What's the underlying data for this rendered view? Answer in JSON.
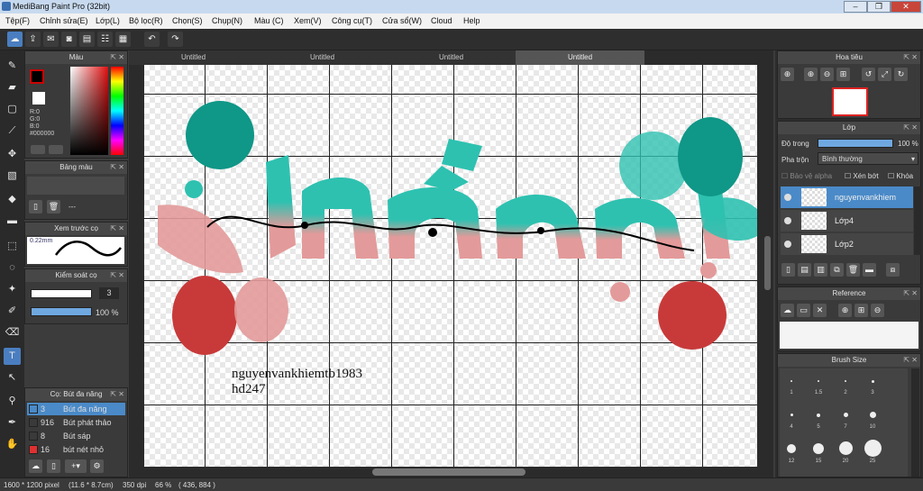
{
  "app": {
    "title": "MediBang Paint Pro (32bit)"
  },
  "menu": [
    "Tệp(F)",
    "Chỉnh sửa(E)",
    "Lớp(L)",
    "Bộ lọc(R)",
    "Chọn(S)",
    "Chụp(N)",
    "Màu (C)",
    "Xem(V)",
    "Công cụ(T)",
    "Cửa sổ(W)",
    "Cloud",
    "Help"
  ],
  "tabs": [
    "Untitled",
    "Untitled",
    "Untitled",
    "Untitled"
  ],
  "color_panel": {
    "title": "Màu",
    "r": "R:0",
    "g": "G:0",
    "b": "B:0",
    "hex": "#000000",
    "foreground": "#000000",
    "background": "#ffffff",
    "hue": "#ff0000"
  },
  "palette_panel": {
    "title": "Bảng màu",
    "dash": "---"
  },
  "brush_preview_panel": {
    "title": "Xem trước cọ",
    "size": "0.22mm"
  },
  "brush_control_panel": {
    "title": "Kiểm soát cọ",
    "size_value": "3",
    "opacity_value": "100 %"
  },
  "brush_list_panel": {
    "title": "Cọ: Bút đa năng",
    "items": [
      {
        "num": "3",
        "label": "Bút đa năng",
        "color": "#4a8ac8"
      },
      {
        "num": "916",
        "label": "Bút phát thảo",
        "color": "#3a3a3a"
      },
      {
        "num": "8",
        "label": "Bút sáp",
        "color": "#3a3a3a"
      },
      {
        "num": "16",
        "label": "bút nét nhỏ",
        "color": "#e03030"
      }
    ]
  },
  "canvas": {
    "text_line1": "nguyenvankhiemtb1983",
    "text_line2": "hd247",
    "accent_teal": "#2ec1b0",
    "accent_pink": "#e39a9a",
    "accent_red": "#c83a3a"
  },
  "navigator_panel": {
    "title": "Hoa tiêu"
  },
  "layer_panel": {
    "title": "Lớp",
    "opacity_label": "Độ trong",
    "opacity_value": "100 %",
    "blend_label": "Pha trộn",
    "blend_value": "Bình thường",
    "protect_alpha": "Bảo vệ alpha",
    "clipping": "Xén bớt",
    "lock": "Khóa",
    "layers": [
      {
        "name": "nguyenvankhiem",
        "selected": true
      },
      {
        "name": "Lớp4",
        "selected": false
      },
      {
        "name": "Lớp2",
        "selected": false
      }
    ]
  },
  "reference_panel": {
    "title": "Reference"
  },
  "brush_size_panel": {
    "title": "Brush Size",
    "sizes": [
      "1",
      "1.5",
      "2",
      "3",
      "4",
      "5",
      "7",
      "10",
      "12",
      "15",
      "20",
      "25"
    ]
  },
  "status": {
    "pixels": "1600 * 1200 pixel",
    "cm": "(11.6 * 8.7cm)",
    "dpi": "350 dpi",
    "zoom": "66 %",
    "coords": "( 436, 884 )"
  }
}
